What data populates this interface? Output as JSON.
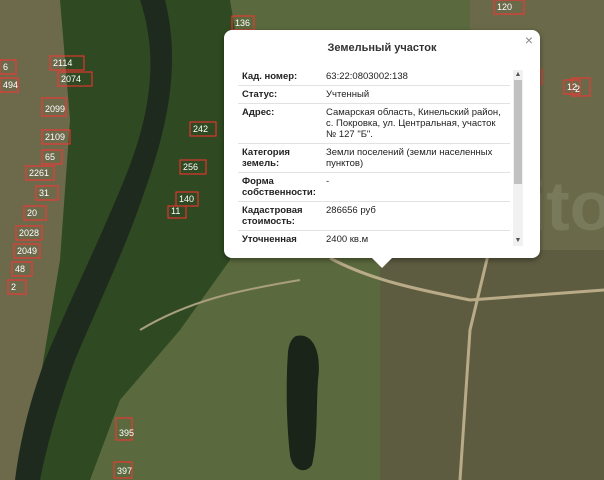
{
  "popup": {
    "title": "Земельный участок",
    "close_label": "×",
    "rows": [
      {
        "key": "Кад. номер:",
        "value": "63:22:0803002:138"
      },
      {
        "key": "Статус:",
        "value": "Учтенный"
      },
      {
        "key": "Адрес:",
        "value": "Самарская область, Кинельский район, с. Покровка, ул. Центральная, участок № 127 \"Б\"."
      },
      {
        "key": "Категория земель:",
        "value": "Земли поселений (земли населенных пунктов)"
      },
      {
        "key": "Форма собственности:",
        "value": "-"
      },
      {
        "key": "Кадастровая стоимость:",
        "value": "286656 руб"
      },
      {
        "key": "Уточненная площадь:",
        "value": "2400 кв.м"
      }
    ]
  },
  "map": {
    "parcel_labels": [
      "136",
      "120",
      "14",
      "2",
      "6",
      "494",
      "2114",
      "2074",
      "2099",
      "2109",
      "65",
      "2261",
      "31",
      "20",
      "2028",
      "2049",
      "48",
      "2",
      "242",
      "256",
      "140",
      "11",
      "12",
      "395",
      "397"
    ],
    "watermark": "Avito",
    "colors": {
      "parcel_border": "#ff3030",
      "river": "#1f2a1e",
      "forest": "#2f4a22",
      "field": "#6b7a4c"
    }
  }
}
